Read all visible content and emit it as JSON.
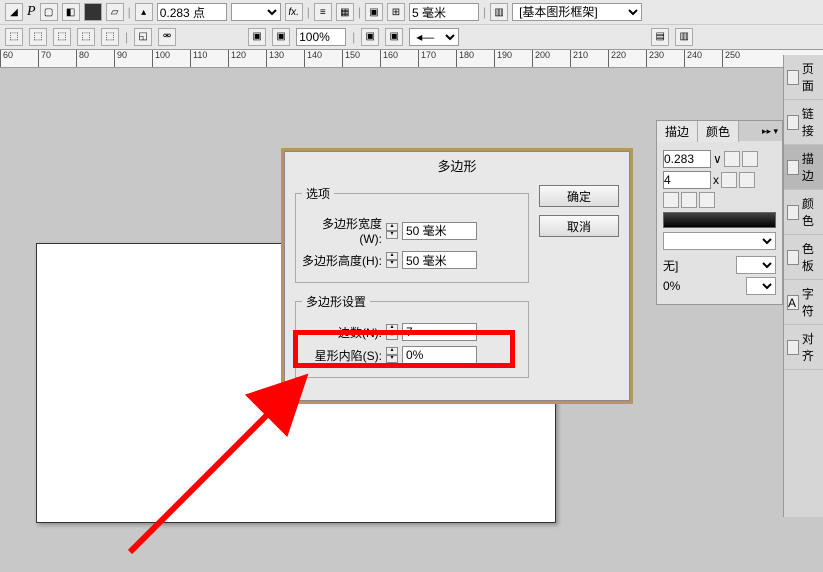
{
  "toolbar": {
    "stroke_pt": "0.283 点",
    "zoom_pct": "100%",
    "size_field": "5 毫米",
    "frame_label": "[基本图形框架]"
  },
  "ruler": {
    "ticks": [
      "60",
      "70",
      "80",
      "90",
      "100",
      "110",
      "120",
      "130",
      "140",
      "150",
      "160",
      "170",
      "180",
      "190",
      "200",
      "210",
      "220",
      "230",
      "240",
      "250"
    ]
  },
  "dialog": {
    "title": "多边形",
    "ok": "确定",
    "cancel": "取消",
    "options_legend": "选项",
    "width_label": "多边形宽度(W):",
    "width_value": "50 毫米",
    "height_label": "多边形高度(H):",
    "height_value": "50 毫米",
    "settings_legend": "多边形设置",
    "sides_label": "边数(N):",
    "sides_value": "7",
    "inset_label": "星形内陷(S):",
    "inset_value": "0%"
  },
  "side_panel": {
    "tab_stroke": "描边",
    "tab_color": "颜色",
    "stroke_width": "0.283",
    "miter": "4",
    "x_label": "x",
    "none_label": "无]",
    "pct": "0%"
  },
  "far_items": {
    "page": "页面",
    "link": "链接",
    "stroke": "描边",
    "color": "颜色",
    "swatch": "色板",
    "char": "字符",
    "align": "对齐"
  }
}
